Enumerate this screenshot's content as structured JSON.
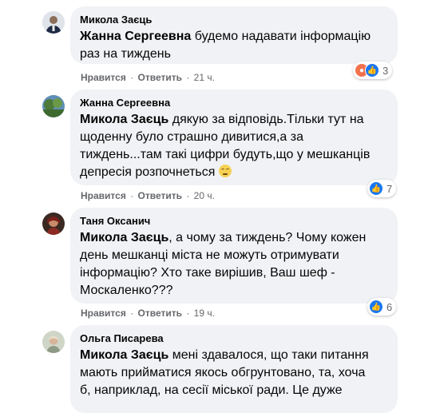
{
  "actions": {
    "like": "Нравится",
    "reply": "Ответить",
    "separator": "·"
  },
  "colors": {
    "bubble": "#f0f2f5",
    "like_blue": "#1877f2",
    "angry_orange": "#f0734d",
    "meta_gray": "#65676b"
  },
  "comments": [
    {
      "author": "Микола Заєць",
      "mention": "Жанна Сергеевна",
      "text_line1": " будемо надавати інформацію",
      "text_line2": "раз на тиждень",
      "time": "21 ч.",
      "reaction_icons": [
        "angry-icon",
        "like-icon"
      ],
      "reaction_count": "3"
    },
    {
      "author": "Жанна Сергеевна",
      "mention": "Микола Заєць",
      "text_line1": " дякую за відповідь.Тільки тут на",
      "text_line2": "щоденну було страшно дивитися,а за",
      "text_line3": "тиждень...там такі цифри будуть,що у мешканців",
      "text_line4": "депресія розпочнеться ",
      "inline_emoji": "sad-face-emoji",
      "time": "20 ч.",
      "reaction_icons": [
        "like-icon"
      ],
      "reaction_count": "7"
    },
    {
      "author": "Таня Оксанич",
      "mention": "Микола Заєць",
      "text_line1": ", а чому за тиждень? Чому кожен",
      "text_line2": "день мешканці міста не можуть отримувати",
      "text_line3": "інформацію? Хто таке вирішив, Ваш шеф -",
      "text_line4": "Москаленко???",
      "time": "19 ч.",
      "reaction_icons": [
        "like-icon"
      ],
      "reaction_count": "6"
    },
    {
      "author": "Ольга Писарева",
      "mention": "Микола Заєць",
      "text_line1": " мені здавалося, що таки питання",
      "text_line2": "мають прийматися якось обгрунтовано, та, хоча",
      "text_line3": "б, наприклад, на сесії міської ради. Це дуже"
    }
  ]
}
